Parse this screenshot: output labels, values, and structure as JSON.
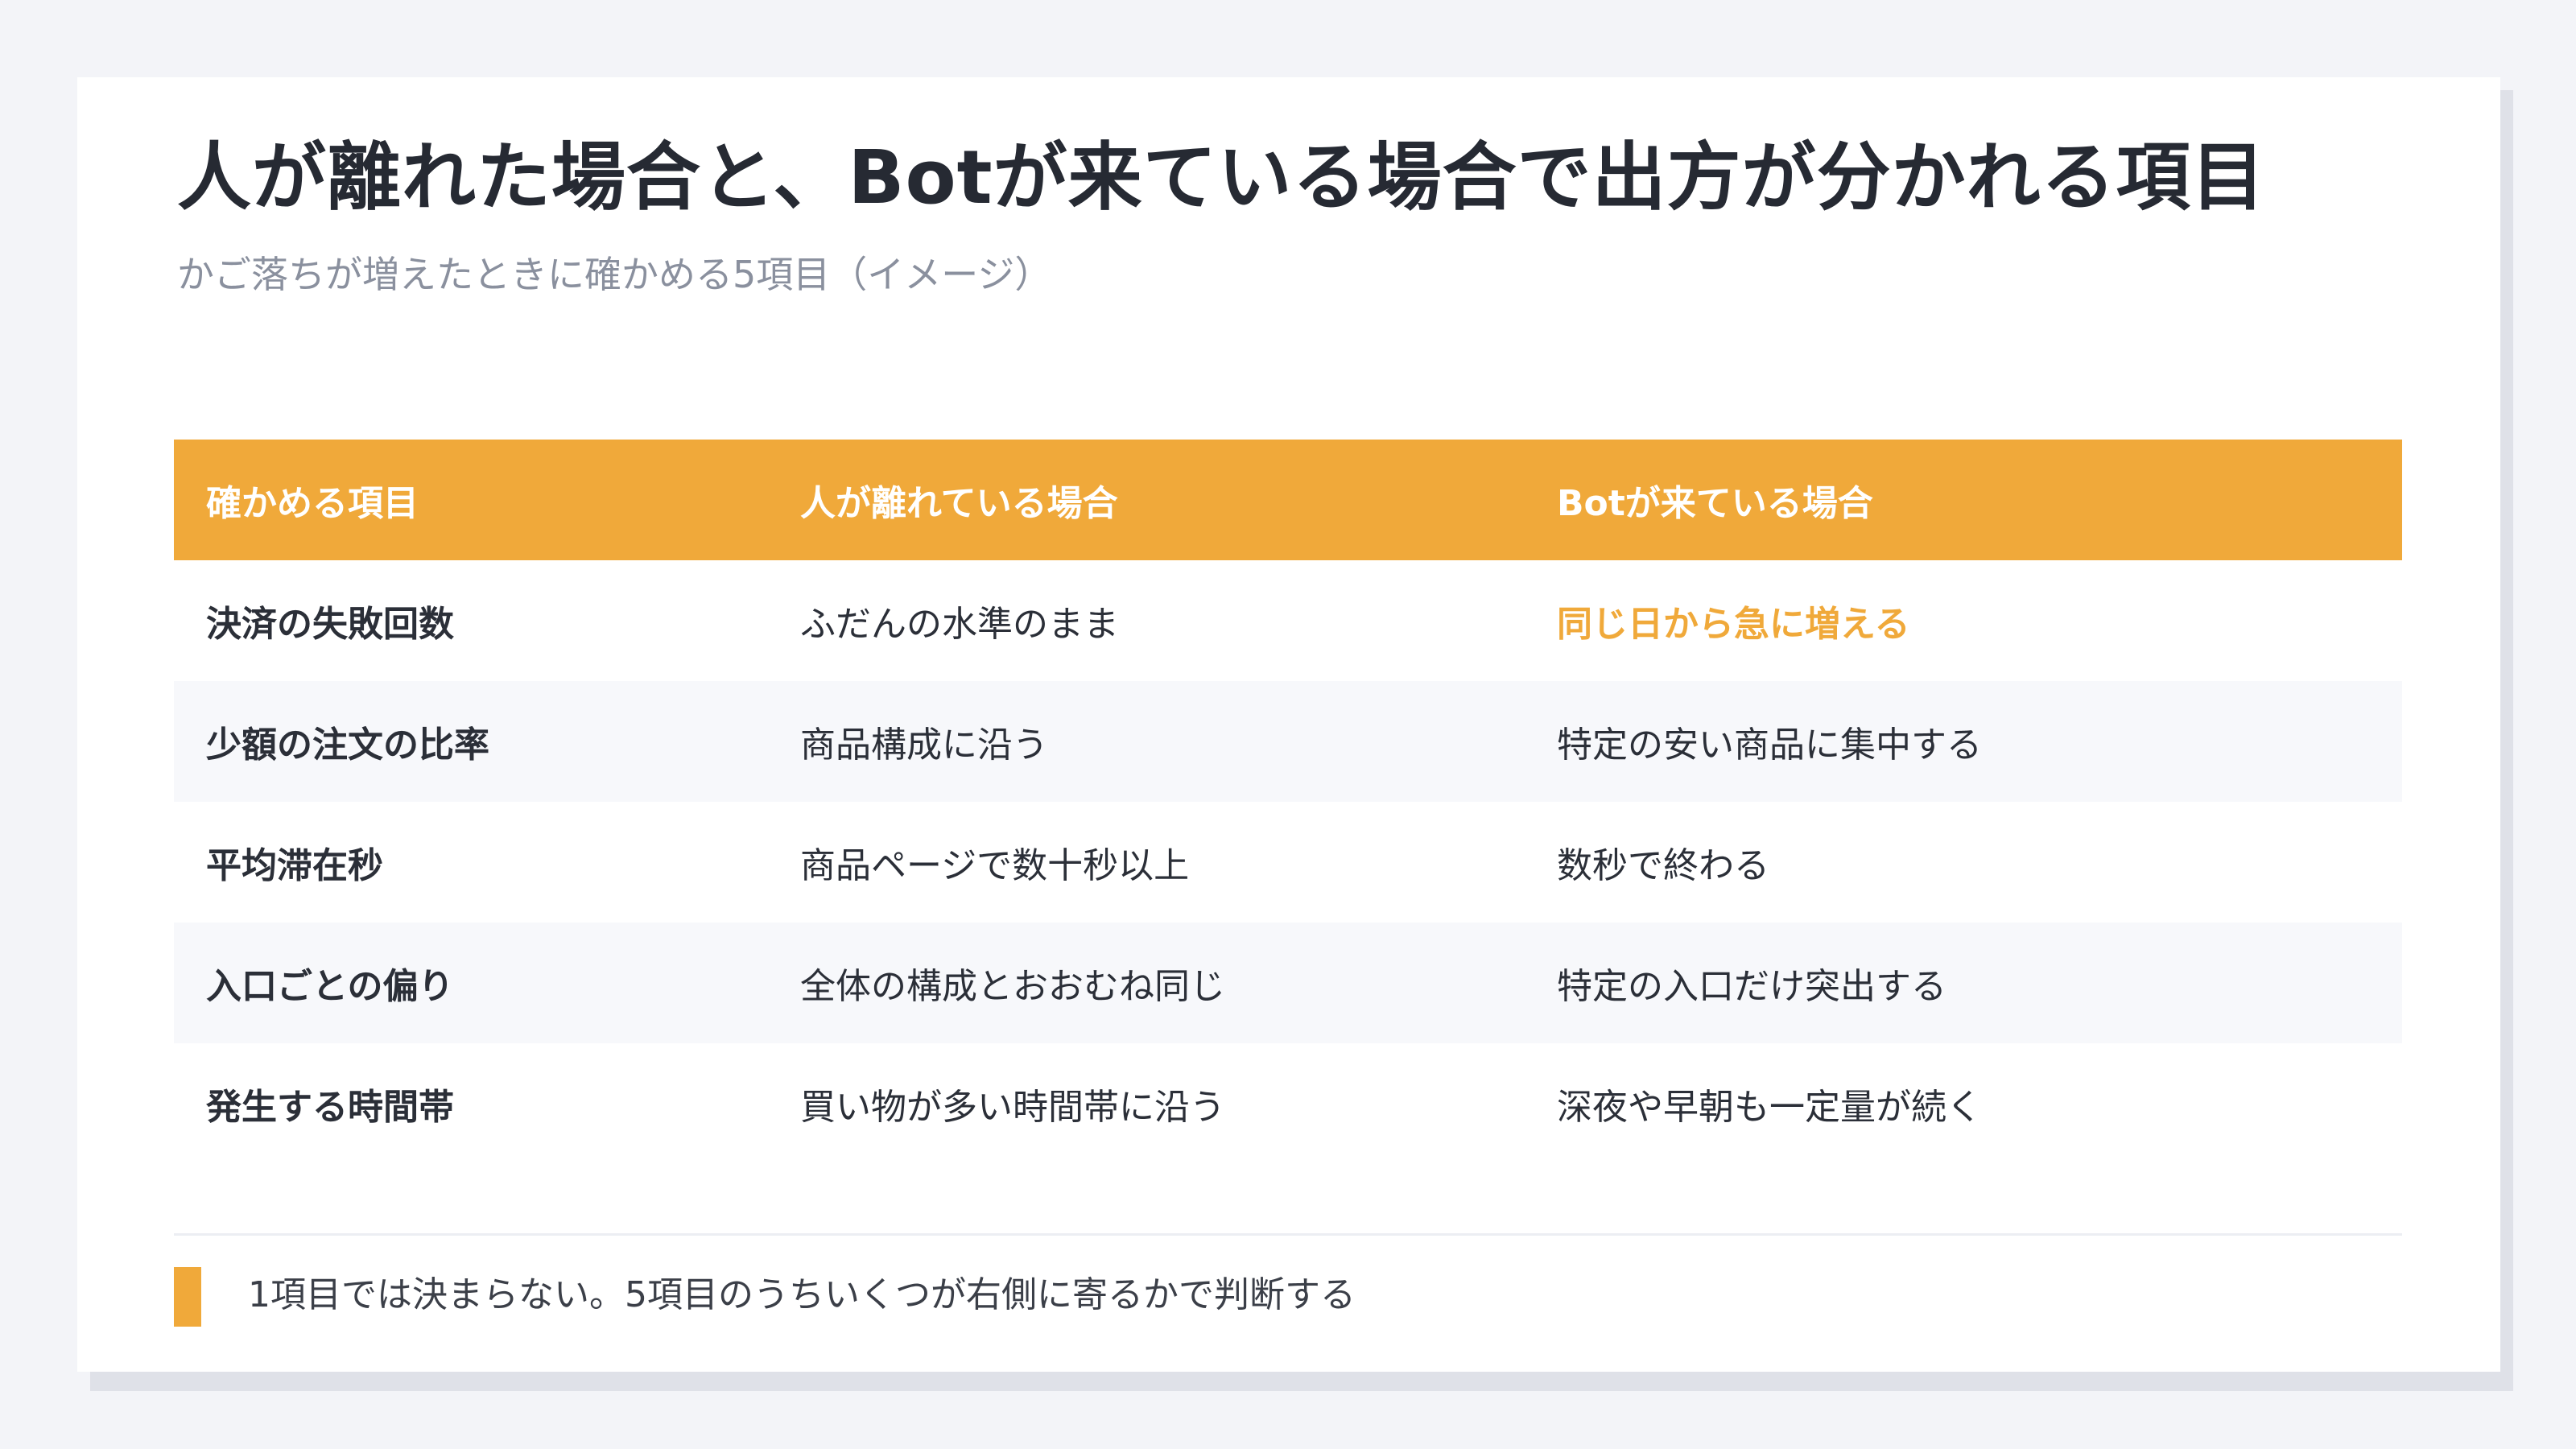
{
  "slide": {
    "title": "人が離れた場合と、Botが来ている場合で出方が分かれる項目",
    "subtitle": "かご落ちが増えたときに確かめる5項目（イメージ）"
  },
  "table": {
    "headers": [
      "確かめる項目",
      "人が離れている場合",
      "Botが来ている場合"
    ],
    "rows": [
      [
        "決済の失敗回数",
        "ふだんの水準のまま",
        "同じ日から急に増える"
      ],
      [
        "少額の注文の比率",
        "商品構成に沿う",
        "特定の安い商品に集中する"
      ],
      [
        "平均滞在秒",
        "商品ページで数十秒以上",
        "数秒で終わる"
      ],
      [
        "入口ごとの偏り",
        "全体の構成とおおむね同じ",
        "特定の入口だけ突出する"
      ],
      [
        "発生する時間帯",
        "買い物が多い時間帯に沿う",
        "深夜や早朝も一定量が続く"
      ]
    ]
  },
  "footer": {
    "note": "1項目では決まらない。5項目のうちいくつが右側に寄るかで判断する"
  },
  "colors": {
    "accent": "#f0a93a",
    "text": "#262a33",
    "muted": "#8a909e",
    "stripe": "#f7f8fb",
    "page_bg": "#f3f4f8"
  }
}
